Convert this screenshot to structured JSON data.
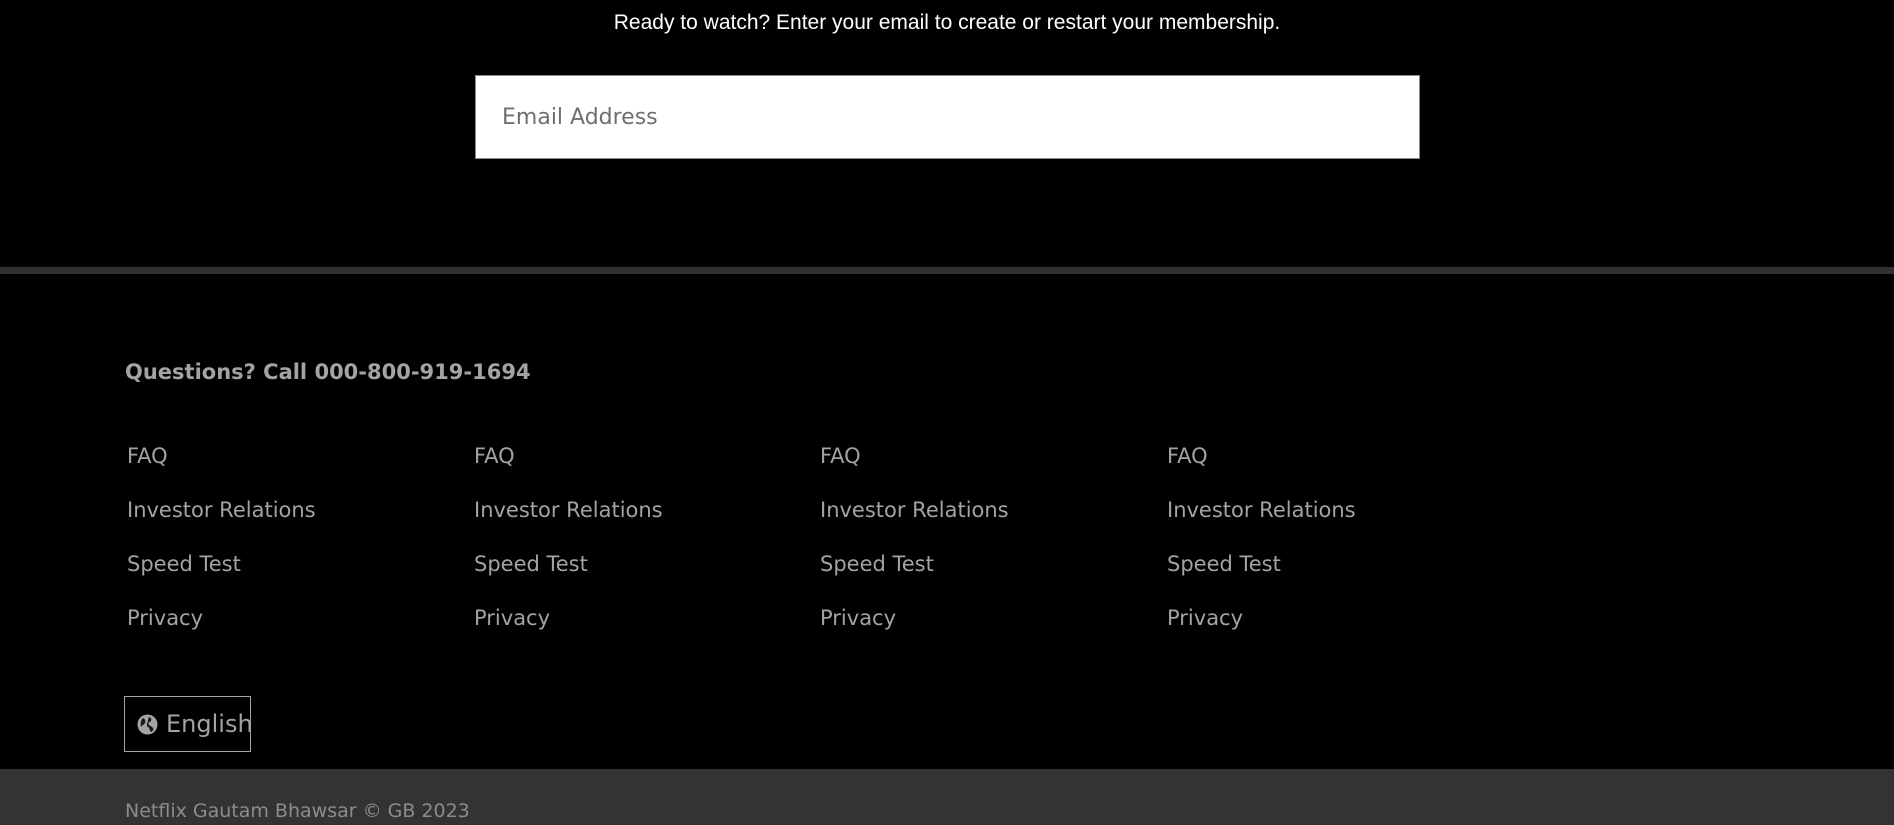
{
  "cta": {
    "text": "Ready to watch? Enter your email to create or restart your membership."
  },
  "email": {
    "placeholder": "Email Address",
    "value": ""
  },
  "footer": {
    "question_prefix": "Questions? Call ",
    "phone": "000-800-919-1694",
    "columns": [
      {
        "links": [
          "FAQ",
          "Investor Relations",
          "Speed Test",
          "Privacy"
        ]
      },
      {
        "links": [
          "FAQ",
          "Investor Relations",
          "Speed Test",
          "Privacy"
        ]
      },
      {
        "links": [
          "FAQ",
          "Investor Relations",
          "Speed Test",
          "Privacy"
        ]
      },
      {
        "links": [
          "FAQ",
          "Investor Relations",
          "Speed Test",
          "Privacy"
        ]
      }
    ],
    "language": {
      "icon": "globe-icon",
      "label": "English"
    },
    "copyright": "Netflix Gautam Bhawsar © GB 2023"
  },
  "colors": {
    "background": "#000000",
    "divider": "#303030",
    "footer_text": "#a3a3a3",
    "bottom_bar": "#333333"
  }
}
